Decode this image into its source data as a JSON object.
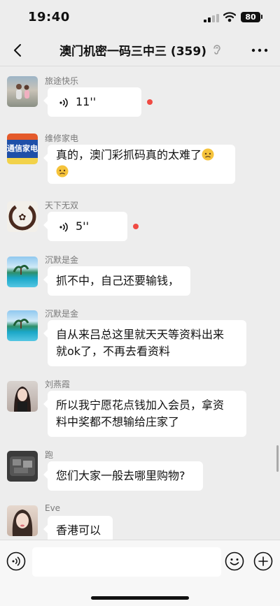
{
  "status_bar": {
    "time": "19:40",
    "battery": "80"
  },
  "nav": {
    "title": "澳门机密一码三中三 (359)",
    "icons": {
      "back": "chevron-left-icon",
      "mute": "ear-icon",
      "more": "ellipsis-icon"
    }
  },
  "messages": [
    {
      "sender": "旅途快乐",
      "type": "voice",
      "duration": "11''",
      "unread": true
    },
    {
      "sender": "维修家电",
      "type": "text",
      "text": "真的，澳门彩抓码真的太难了",
      "avatar_text": "通信家电"
    },
    {
      "sender": "天下无双",
      "type": "voice",
      "duration": "5''",
      "unread": true
    },
    {
      "sender": "沉默是金",
      "type": "text",
      "text": "抓不中，自己还要输钱，"
    },
    {
      "sender": "沉默是金",
      "type": "text",
      "line1": "自从来吕总这里就天天等资料出来",
      "line2": "就ok了，不再去看资料"
    },
    {
      "sender": "刘燕霞",
      "type": "text",
      "line1": "所以我宁愿花点钱加入会员，拿资",
      "line2": "料中奖都不想输给庄家了"
    },
    {
      "sender": "跑",
      "type": "text",
      "text": "您们大家一般去哪里购物?"
    },
    {
      "sender": "Eve",
      "type": "text",
      "text": "香港可以"
    }
  ],
  "input_bar": {
    "message_placeholder": "",
    "icons": {
      "voice": "voice-toggle-icon",
      "emoji": "emoji-icon",
      "add": "plus-icon"
    }
  },
  "colors": {
    "background": "#ededed",
    "bubble": "#ffffff",
    "unread_dot": "#f04a43"
  }
}
